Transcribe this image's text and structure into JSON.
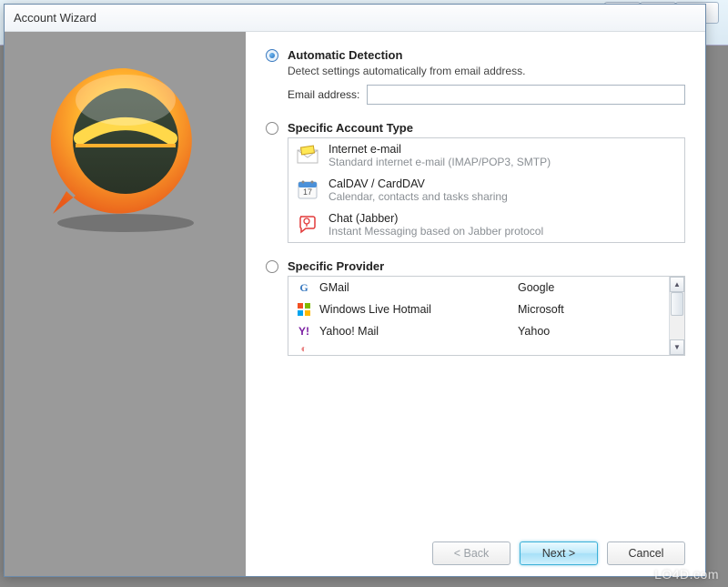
{
  "window": {
    "title": "Account Wizard"
  },
  "automatic": {
    "label": "Automatic Detection",
    "description": "Detect settings automatically from email address.",
    "field_label": "Email address:",
    "value": ""
  },
  "specific_type": {
    "label": "Specific Account Type",
    "items": [
      {
        "title": "Internet e-mail",
        "desc": "Standard internet e-mail (IMAP/POP3, SMTP)"
      },
      {
        "title": "CalDAV / CardDAV",
        "desc": "Calendar, contacts and tasks sharing"
      },
      {
        "title": "Chat (Jabber)",
        "desc": "Instant Messaging based on Jabber protocol"
      }
    ]
  },
  "specific_provider": {
    "label": "Specific Provider",
    "items": [
      {
        "name": "GMail",
        "company": "Google"
      },
      {
        "name": "Windows Live Hotmail",
        "company": "Microsoft"
      },
      {
        "name": "Yahoo! Mail",
        "company": "Yahoo"
      }
    ]
  },
  "buttons": {
    "back": "< Back",
    "next": "Next >",
    "cancel": "Cancel"
  },
  "watermark": "LO4D.com"
}
